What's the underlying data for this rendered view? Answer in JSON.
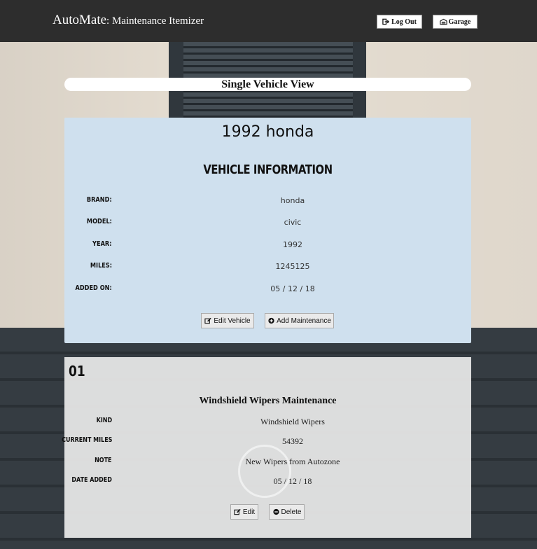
{
  "header": {
    "brand_main": "AutoMate",
    "brand_sub": ": Maintenance Itemizer",
    "logout_label": "Log Out",
    "garage_label": "Garage"
  },
  "page_title": "Single Vehicle View",
  "vehicle": {
    "heading": "1992 honda",
    "subheading": "VEHICLE INFORMATION",
    "fields": [
      {
        "label": "BRAND:",
        "value": "honda"
      },
      {
        "label": "MODEL:",
        "value": "civic"
      },
      {
        "label": "YEAR:",
        "value": "1992"
      },
      {
        "label": "MILES:",
        "value": "1245125"
      },
      {
        "label": "ADDED ON:",
        "value": "05 / 12 / 18"
      }
    ],
    "edit_label": "Edit Vehicle",
    "add_maintenance_label": "Add Maintenance"
  },
  "maintenance": {
    "number": "01",
    "title": "Windshield Wipers Maintenance",
    "fields": [
      {
        "label": "KIND",
        "value": "Windshield Wipers"
      },
      {
        "label": "CURRENT MILES",
        "value": "54392"
      },
      {
        "label": "NOTE",
        "value": "New Wipers from Autozone"
      },
      {
        "label": "DATE ADDED",
        "value": "05 / 12 / 18"
      }
    ],
    "edit_label": "Edit",
    "delete_label": "Delete"
  },
  "icons": {
    "logout": "sign-out-icon",
    "garage": "garage-icon",
    "edit": "edit-icon",
    "add": "plus-circle-icon",
    "delete": "minus-circle-icon"
  }
}
